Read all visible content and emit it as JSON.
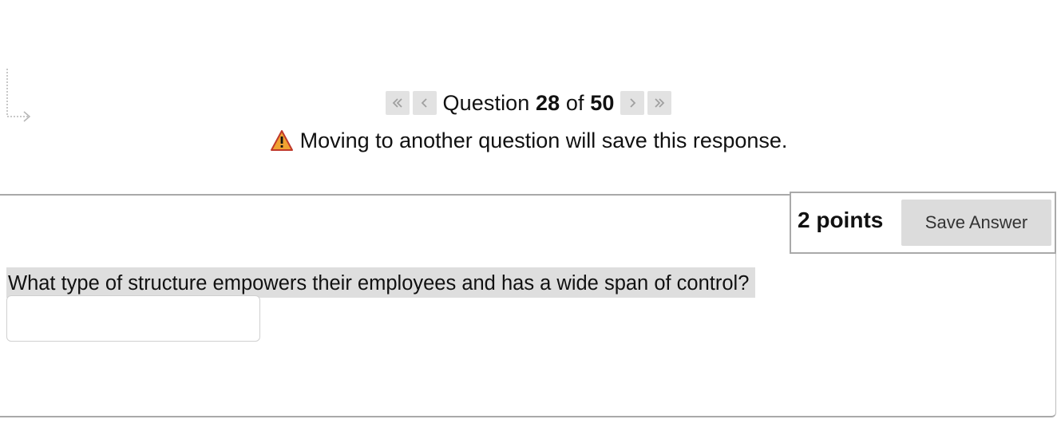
{
  "navigation": {
    "question_label": "Question",
    "current": "28",
    "of_label": "of",
    "total": "50",
    "first_icon": "double-chevron-left-icon",
    "prev_icon": "chevron-left-icon",
    "next_icon": "chevron-right-icon",
    "last_icon": "double-chevron-right-icon"
  },
  "warning": {
    "icon": "warning-triangle-icon",
    "text": "Moving to another question will save this response."
  },
  "question": {
    "points": "2 points",
    "save_label": "Save Answer",
    "text": "What type of structure empowers their employees and has a wide span of control?",
    "answer_value": ""
  },
  "colors": {
    "button_bg": "#e2e2e2",
    "warning_orange": "#f0a232",
    "highlight": "#dedede"
  }
}
